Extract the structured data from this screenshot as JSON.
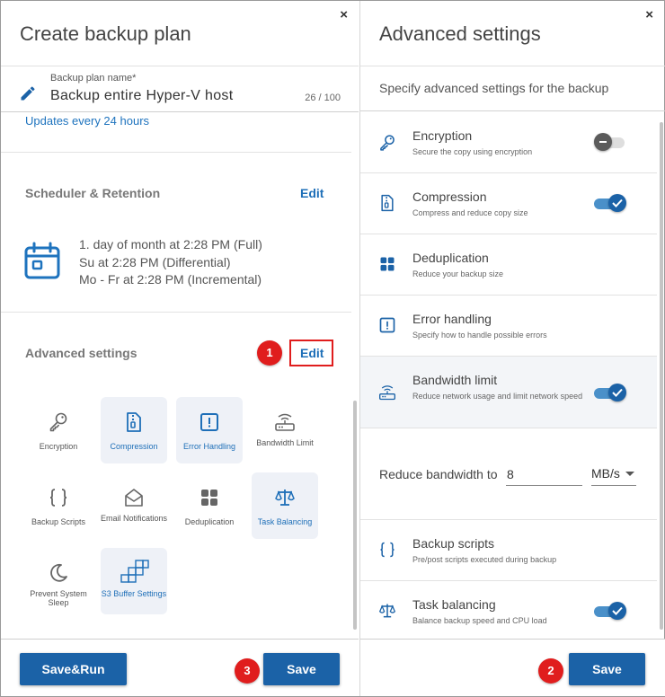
{
  "left": {
    "title": "Create backup plan",
    "close": "×",
    "plan_name": {
      "label": "Backup plan name*",
      "value": "Backup entire Hyper-V host",
      "count": "26 / 100"
    },
    "updates": "Updates every 24 hours",
    "scheduler": {
      "title": "Scheduler & Retention",
      "edit": "Edit",
      "lines": [
        "1. day of month at 2:28 PM (Full)",
        "Su at 2:28 PM (Differential)",
        "Mo - Fr at 2:28 PM (Incremental)"
      ]
    },
    "advanced": {
      "title": "Advanced settings",
      "edit": "Edit",
      "tiles": [
        {
          "label": "Encryption",
          "icon": "key-icon",
          "active": false
        },
        {
          "label": "Compression",
          "icon": "file-zip-icon",
          "active": true
        },
        {
          "label": "Error Handling",
          "icon": "exclamation-square-icon",
          "active": true
        },
        {
          "label": "Bandwidth Limit",
          "icon": "router-icon",
          "active": false
        },
        {
          "label": "Backup Scripts",
          "icon": "braces-icon",
          "active": false
        },
        {
          "label": "Email Notifications",
          "icon": "envelope-open-icon",
          "active": false
        },
        {
          "label": "Deduplication",
          "icon": "grid-icon",
          "active": false
        },
        {
          "label": "Task Balancing",
          "icon": "scales-icon",
          "active": true
        },
        {
          "label": "Prevent System Sleep",
          "icon": "moon-icon",
          "active": false
        },
        {
          "label": "S3 Buffer Settings",
          "icon": "cubes-icon",
          "active": true
        }
      ]
    },
    "buttons": {
      "save_run": "Save&Run",
      "save": "Save"
    }
  },
  "right": {
    "title": "Advanced settings",
    "close": "×",
    "subtitle": "Specify advanced settings for the backup",
    "rows": [
      {
        "title": "Encryption",
        "desc": "Secure the copy using encryption",
        "icon": "key-icon",
        "toggle": "off"
      },
      {
        "title": "Compression",
        "desc": "Compress and reduce copy size",
        "icon": "file-zip-icon",
        "toggle": "on"
      },
      {
        "title": "Deduplication",
        "desc": "Reduce your backup size",
        "icon": "grid-icon",
        "toggle": "none"
      },
      {
        "title": "Error handling",
        "desc": "Specify how to handle possible errors",
        "icon": "exclamation-square-icon",
        "toggle": "none"
      },
      {
        "title": "Bandwidth limit",
        "desc": "Reduce network usage and limit network speed",
        "icon": "router-icon",
        "toggle": "on"
      },
      {
        "title": "Backup scripts",
        "desc": "Pre/post scripts executed during backup",
        "icon": "braces-icon",
        "toggle": "none"
      },
      {
        "title": "Task balancing",
        "desc": "Balance backup speed and CPU load",
        "icon": "scales-icon",
        "toggle": "on"
      }
    ],
    "bandwidth": {
      "label": "Reduce bandwidth to",
      "value": "8",
      "unit": "MB/s"
    },
    "buttons": {
      "save": "Save"
    }
  },
  "badges": [
    "1",
    "2",
    "3"
  ],
  "colors": {
    "accent": "#1b62a7",
    "link": "#1e73be",
    "badge": "#e01d1d",
    "active_tile": "#eef1f7"
  }
}
